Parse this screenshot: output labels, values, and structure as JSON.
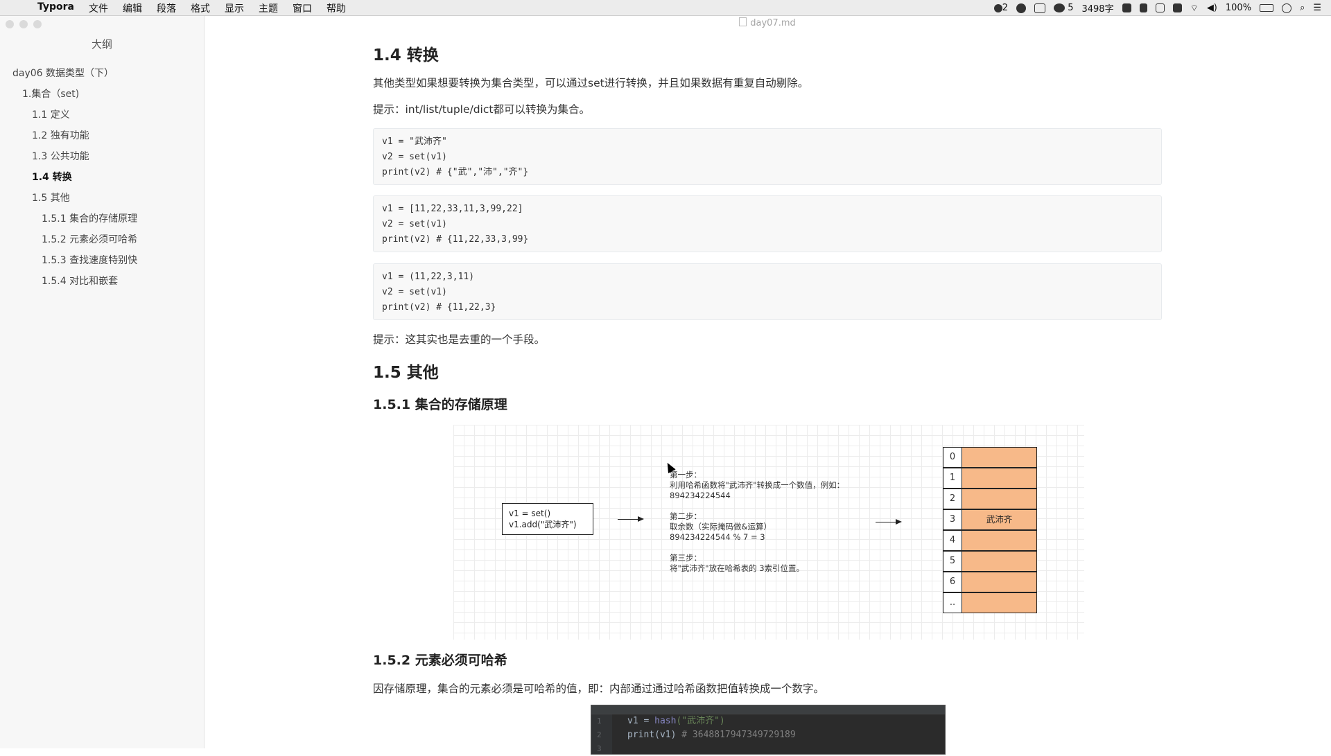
{
  "menubar": {
    "app": "Typora",
    "menus": [
      "文件",
      "编辑",
      "段落",
      "格式",
      "显示",
      "主题",
      "窗口",
      "帮助"
    ],
    "status": {
      "notifications": "2",
      "wechat_count": "5",
      "word_count": "3498字",
      "battery": "100%"
    }
  },
  "window": {
    "file_name": "day07.md"
  },
  "sidebar": {
    "title": "大纲",
    "items": [
      {
        "label": "day06 数据类型（下）",
        "level": 1
      },
      {
        "label": "1.集合（set)",
        "level": 2
      },
      {
        "label": "1.1 定义",
        "level": 3
      },
      {
        "label": "1.2 独有功能",
        "level": 3
      },
      {
        "label": "1.3 公共功能",
        "level": 3
      },
      {
        "label": "1.4 转换",
        "level": 3,
        "active": true
      },
      {
        "label": "1.5 其他",
        "level": 3
      },
      {
        "label": "1.5.1 集合的存储原理",
        "level": 4
      },
      {
        "label": "1.5.2 元素必须可哈希",
        "level": 4
      },
      {
        "label": "1.5.3 查找速度特别快",
        "level": 4
      },
      {
        "label": "1.5.4 对比和嵌套",
        "level": 4
      }
    ]
  },
  "content": {
    "h_convert": "1.4 转换",
    "p_convert_1": "其他类型如果想要转换为集合类型，可以通过set进行转换，并且如果数据有重复自动剔除。",
    "p_convert_2": "提示：int/list/tuple/dict都可以转换为集合。",
    "code1": [
      "v1 = \"武沛齐\"",
      "v2 = set(v1)",
      "print(v2) # {\"武\",\"沛\",\"齐\"}"
    ],
    "code2": [
      "v1 = [11,22,33,11,3,99,22]",
      "v2 = set(v1)",
      "print(v2) # {11,22,33,3,99}"
    ],
    "code3": [
      "v1 = (11,22,3,11)",
      "v2 = set(v1)",
      "print(v2) # {11,22,3}"
    ],
    "p_tip": "提示：这其实也是去重的一个手段。",
    "h_other": "1.5 其他",
    "h_storage": "1.5.1 集合的存储原理",
    "diagram": {
      "box_line1": "v1 = set()",
      "box_line2": "v1.add(\"武沛齐\")",
      "step1_title": "第一步：",
      "step1_text": "利用哈希函数将\"武沛齐\"转换成一个数值，例如：",
      "step1_value": "894234224544",
      "step2_title": "第二步：",
      "step2_text": "取余数（实际掩码做&运算）",
      "step2_value": "894234224544 % 7 = 3",
      "step3_title": "第三步：",
      "step3_text": "将\"武沛齐\"放在哈希表的 3索引位置。",
      "table_indices": [
        "0",
        "1",
        "2",
        "3",
        "4",
        "5",
        "6",
        ".."
      ],
      "table_values": [
        "",
        "",
        "",
        "武沛齐",
        "",
        "",
        "",
        ""
      ],
      "slot_color": "#f7b989"
    },
    "h_hashable": "1.5.2 元素必须可哈希",
    "p_hashable": "因存储原理，集合的元素必须是可哈希的值，即：内部通过通过哈希函数把值转换成一个数字。",
    "darkcode": {
      "line_numbers": [
        "1",
        "2",
        "3"
      ],
      "line1_pre": "v1 = ",
      "line1_fn": "hash",
      "line1_arg": "(\"武沛齐\")",
      "line2_pre": "print(v1)  ",
      "line2_comment": "# 3648817947349729189"
    }
  }
}
